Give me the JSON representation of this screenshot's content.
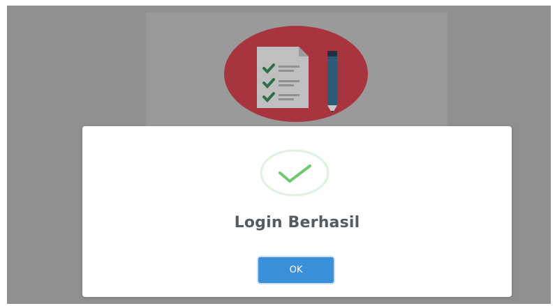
{
  "dialog": {
    "title": "Login Berhasil",
    "ok_label": "OK",
    "icon": "checkmark-success-icon"
  },
  "background": {
    "logo_icon": "checklist-pencil-logo-icon"
  },
  "colors": {
    "overlay": "#8d8f91",
    "card_dimmed": "#9a9a9a",
    "logo_circle": "#a8343f",
    "success_green": "#6dc96d",
    "button_blue": "#3a8fda",
    "title_text": "#555b61"
  }
}
